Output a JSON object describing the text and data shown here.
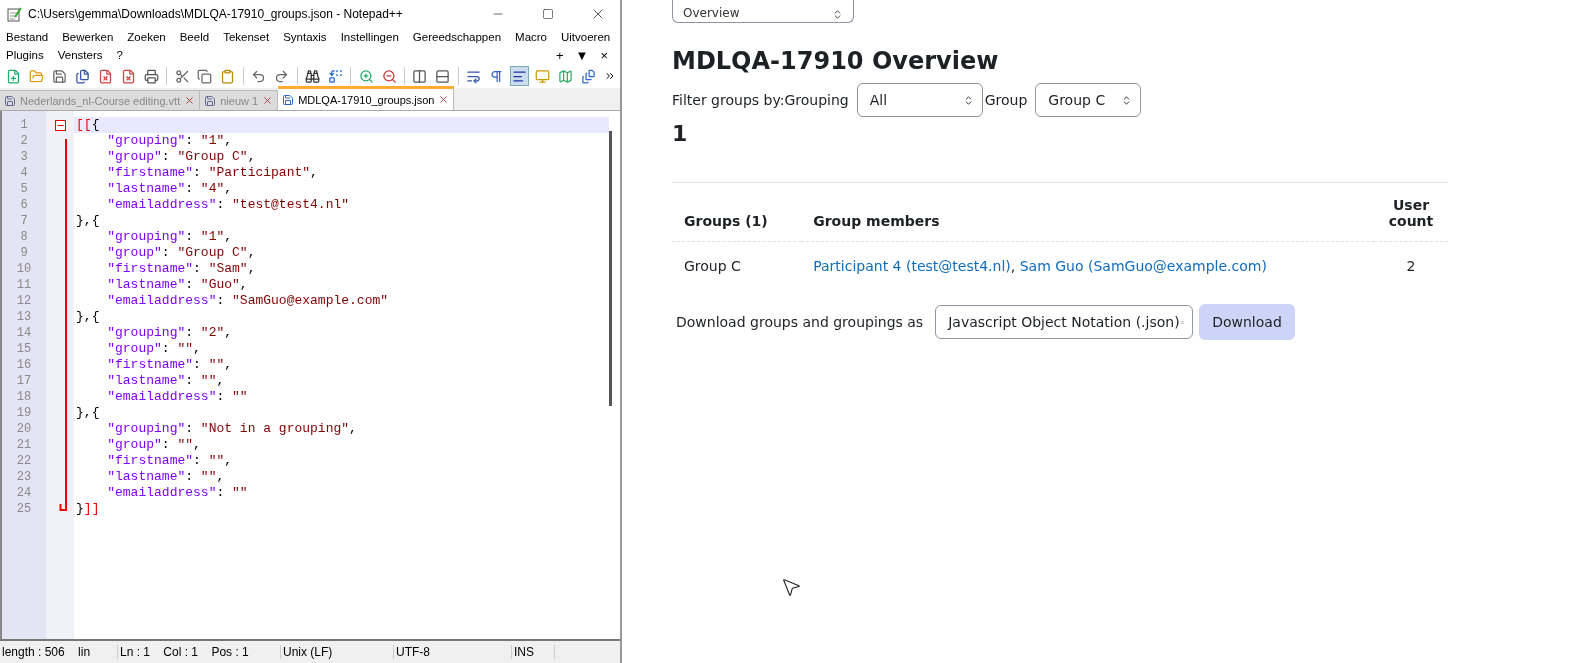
{
  "editor_window": {
    "title": "C:\\Users\\gemma\\Downloads\\MDLQA-17910_groups.json - Notepad++",
    "menu_row_1": [
      "Bestand",
      "Bewerken",
      "Zoeken",
      "Beeld",
      "Tekenset",
      "Syntaxis",
      "Instellingen",
      "Gereedschappen",
      "Macro",
      "Uitvoeren"
    ],
    "menu_row_2": [
      "Plugins",
      "Vensters",
      "?"
    ],
    "menu_controls": [
      "+",
      "▼",
      "×"
    ],
    "tabs": [
      {
        "label": "Nederlands_nl-Course editing.vtt",
        "selected": false
      },
      {
        "label": "nieuw 1",
        "selected": false
      },
      {
        "label": "MDLQA-17910_groups.json",
        "selected": true
      }
    ],
    "lines": [
      {
        "number": "1",
        "text": "[[{",
        "fold_start": true
      },
      {
        "number": "2",
        "text": "    \"grouping\": \"1\","
      },
      {
        "number": "3",
        "text": "    \"group\": \"Group C\","
      },
      {
        "number": "4",
        "text": "    \"firstname\": \"Participant\","
      },
      {
        "number": "5",
        "text": "    \"lastname\": \"4\","
      },
      {
        "number": "6",
        "text": "    \"emailaddress\": \"test@test4.nl\""
      },
      {
        "number": "7",
        "text": "},{"
      },
      {
        "number": "8",
        "text": "    \"grouping\": \"1\","
      },
      {
        "number": "9",
        "text": "    \"group\": \"Group C\","
      },
      {
        "number": "10",
        "text": "    \"firstname\": \"Sam\","
      },
      {
        "number": "11",
        "text": "    \"lastname\": \"Guo\","
      },
      {
        "number": "12",
        "text": "    \"emailaddress\": \"SamGuo@example.com\""
      },
      {
        "number": "13",
        "text": "},{"
      },
      {
        "number": "14",
        "text": "    \"grouping\": \"2\","
      },
      {
        "number": "15",
        "text": "    \"group\": \"\","
      },
      {
        "number": "16",
        "text": "    \"firstname\": \"\","
      },
      {
        "number": "17",
        "text": "    \"lastname\": \"\","
      },
      {
        "number": "18",
        "text": "    \"emailaddress\": \"\""
      },
      {
        "number": "19",
        "text": "},{"
      },
      {
        "number": "20",
        "text": "    \"grouping\": \"Not in a grouping\","
      },
      {
        "number": "21",
        "text": "    \"group\": \"\","
      },
      {
        "number": "22",
        "text": "    \"firstname\": \"\","
      },
      {
        "number": "23",
        "text": "    \"lastname\": \"\","
      },
      {
        "number": "24",
        "text": "    \"emailaddress\": \"\""
      },
      {
        "number": "25",
        "text": "}]]",
        "fold_end": true
      }
    ],
    "status_bar": [
      "length : 506    lin",
      "Ln : 1    Col : 1    Pos : 1",
      "Unix (LF)",
      "UTF-8",
      "INS"
    ]
  },
  "report_page": {
    "view_select": "Overview",
    "heading": "MDLQA-17910 Overview",
    "filter_label": "Filter groups by:",
    "grouping_label": "Grouping",
    "grouping_value": "All",
    "group_label": "Group",
    "group_value": "Group C",
    "grouping_title": "1",
    "table": {
      "columns": [
        "Groups (1)",
        "Group members",
        "User count"
      ],
      "rows": [
        {
          "group": "Group C",
          "separator": ",",
          "members": [
            {
              "name": "Participant 4 (test@test4.nl)"
            },
            {
              "name": "Sam Guo (SamGuo@example.com)"
            }
          ],
          "count": "2"
        }
      ]
    },
    "download_label": "Download groups and groupings as",
    "download_format": "Javascript Object Notation (.json)",
    "download_button": "Download"
  }
}
